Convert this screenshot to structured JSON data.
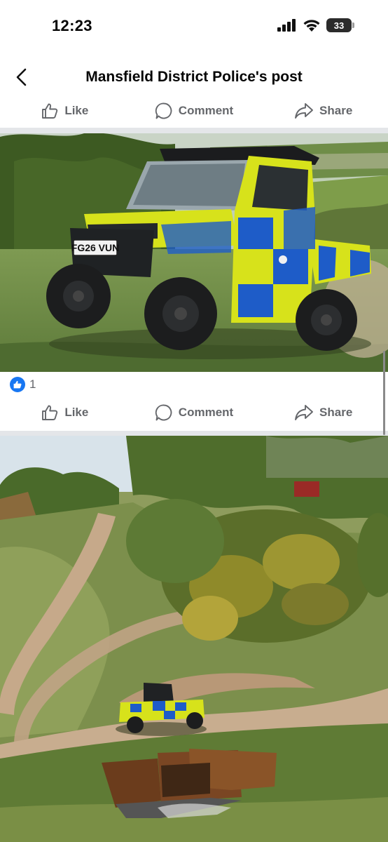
{
  "status_bar": {
    "time": "12:23",
    "battery_level": "33"
  },
  "nav": {
    "title": "Mansfield District Police's post"
  },
  "post1": {
    "actions": {
      "like": "Like",
      "comment": "Comment",
      "share": "Share"
    },
    "vehicle_plate": "FG26 VUN",
    "reactions": {
      "count": "1"
    }
  },
  "post2": {
    "actions": {
      "like": "Like",
      "comment": "Comment",
      "share": "Share"
    }
  },
  "colors": {
    "accent": "#1877f2",
    "action_text": "#65676b",
    "police_yellow": "#d7e21b",
    "police_blue": "#1e5cc8"
  }
}
